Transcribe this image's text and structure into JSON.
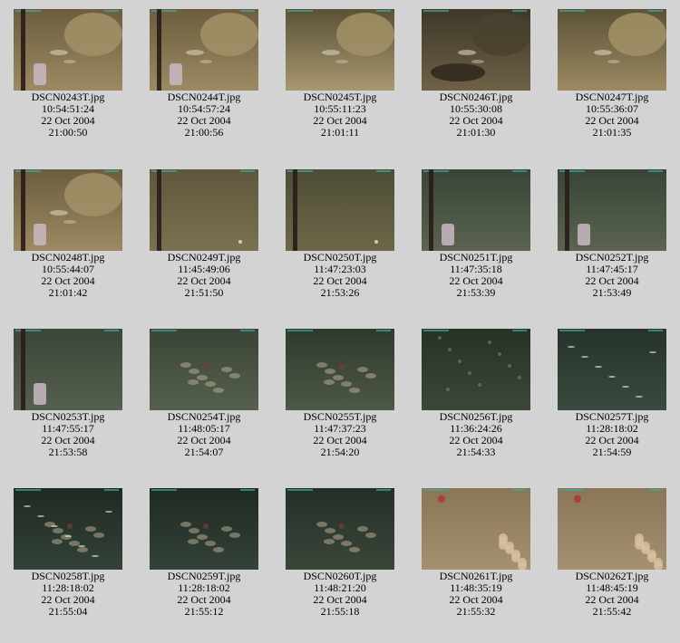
{
  "gallery": {
    "items": [
      {
        "filename": "DSCN0243T.jpg",
        "camera_time": "10:54:51:24",
        "date": "22 Oct 2004",
        "time": "21:00:50",
        "scene": "rock-pole",
        "colors": [
          "#6b5d3e",
          "#9c8a63"
        ]
      },
      {
        "filename": "DSCN0244T.jpg",
        "camera_time": "10:54:57:24",
        "date": "22 Oct 2004",
        "time": "21:00:56",
        "scene": "rock-pole",
        "colors": [
          "#6b5d3e",
          "#9c8a63"
        ]
      },
      {
        "filename": "DSCN0245T.jpg",
        "camera_time": "10:55:11:23",
        "date": "22 Oct 2004",
        "time": "21:01:11",
        "scene": "rock",
        "colors": [
          "#5a5237",
          "#a89870"
        ]
      },
      {
        "filename": "DSCN0246T.jpg",
        "camera_time": "10:55:30:08",
        "date": "22 Oct 2004",
        "time": "21:01:30",
        "scene": "dark-rock",
        "colors": [
          "#3e3828",
          "#6e6147"
        ]
      },
      {
        "filename": "DSCN0247T.jpg",
        "camera_time": "10:55:36:07",
        "date": "22 Oct 2004",
        "time": "21:01:35",
        "scene": "rock",
        "colors": [
          "#5a5237",
          "#9c8a63"
        ]
      },
      {
        "filename": "DSCN0248T.jpg",
        "camera_time": "10:55:44:07",
        "date": "22 Oct 2004",
        "time": "21:01:42",
        "scene": "rock-pole",
        "colors": [
          "#6b5d3e",
          "#9c8a63"
        ]
      },
      {
        "filename": "DSCN0249T.jpg",
        "camera_time": "11:45:49:06",
        "date": "22 Oct 2004",
        "time": "21:51:50",
        "scene": "sand-pole",
        "colors": [
          "#5e573c",
          "#7a7150"
        ]
      },
      {
        "filename": "DSCN0250T.jpg",
        "camera_time": "11:47:23:03",
        "date": "22 Oct 2004",
        "time": "21:53:26",
        "scene": "sand-pole",
        "colors": [
          "#4e4c36",
          "#6b6848"
        ]
      },
      {
        "filename": "DSCN0251T.jpg",
        "camera_time": "11:47:35:18",
        "date": "22 Oct 2004",
        "time": "21:53:39",
        "scene": "green-pole",
        "colors": [
          "#3a4436",
          "#5a6450"
        ]
      },
      {
        "filename": "DSCN0252T.jpg",
        "camera_time": "11:47:45:17",
        "date": "22 Oct 2004",
        "time": "21:53:49",
        "scene": "green-pole",
        "colors": [
          "#3a4436",
          "#5a6450"
        ]
      },
      {
        "filename": "DSCN0253T.jpg",
        "camera_time": "11:47:55:17",
        "date": "22 Oct 2004",
        "time": "21:53:58",
        "scene": "green-pole",
        "colors": [
          "#3b4638",
          "#566050"
        ]
      },
      {
        "filename": "DSCN0254T.jpg",
        "camera_time": "11:48:05:17",
        "date": "22 Oct 2004",
        "time": "21:54:07",
        "scene": "coral",
        "colors": [
          "#3a4436",
          "#55604d"
        ]
      },
      {
        "filename": "DSCN0255T.jpg",
        "camera_time": "11:47:37:23",
        "date": "22 Oct 2004",
        "time": "21:54:20",
        "scene": "coral",
        "colors": [
          "#2f3a2e",
          "#4e5846"
        ]
      },
      {
        "filename": "DSCN0256T.jpg",
        "camera_time": "11:36:24:26",
        "date": "22 Oct 2004",
        "time": "21:54:33",
        "scene": "dark",
        "colors": [
          "#263226",
          "#3b4838"
        ]
      },
      {
        "filename": "DSCN0257T.jpg",
        "camera_time": "11:28:18:02",
        "date": "22 Oct 2004",
        "time": "21:54:59",
        "scene": "fish",
        "colors": [
          "#26332b",
          "#3a4a3e"
        ]
      },
      {
        "filename": "DSCN0258T.jpg",
        "camera_time": "11:28:18:02",
        "date": "22 Oct 2004",
        "time": "21:55:04",
        "scene": "fish-coral",
        "colors": [
          "#1e2a22",
          "#344238"
        ]
      },
      {
        "filename": "DSCN0259T.jpg",
        "camera_time": "11:28:18:02",
        "date": "22 Oct 2004",
        "time": "21:55:12",
        "scene": "coral",
        "colors": [
          "#1e2a22",
          "#344238"
        ]
      },
      {
        "filename": "DSCN0260T.jpg",
        "camera_time": "11:48:21:20",
        "date": "22 Oct 2004",
        "time": "21:55:18",
        "scene": "coral",
        "colors": [
          "#243026",
          "#3a463a"
        ]
      },
      {
        "filename": "DSCN0261T.jpg",
        "camera_time": "11:48:35:19",
        "date": "22 Oct 2004",
        "time": "21:55:32",
        "scene": "sand-shells",
        "colors": [
          "#8a7556",
          "#a69072"
        ]
      },
      {
        "filename": "DSCN0262T.jpg",
        "camera_time": "11:48:45:19",
        "date": "22 Oct 2004",
        "time": "21:55:42",
        "scene": "sand-shells",
        "colors": [
          "#8a7556",
          "#a69072"
        ]
      }
    ]
  }
}
